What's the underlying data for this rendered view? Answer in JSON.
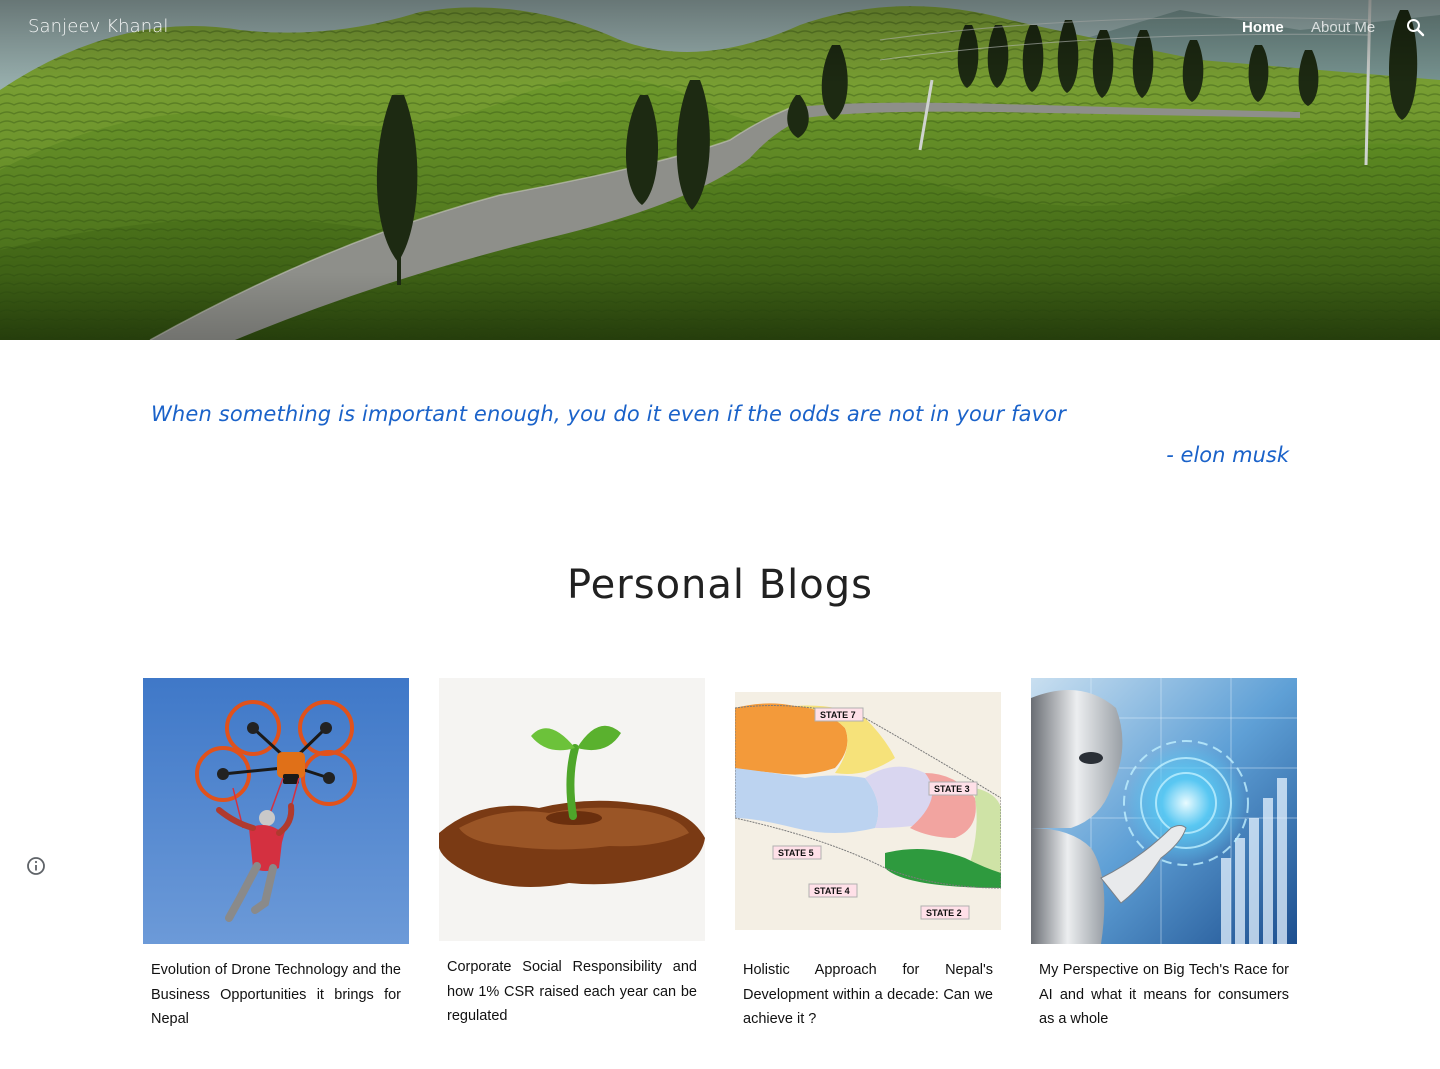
{
  "header": {
    "site_title": "Sanjeev Khanal",
    "nav": {
      "home": "Home",
      "about": "About Me"
    },
    "search_icon": "search-icon",
    "hero_image": "tea-garden-road-landscape"
  },
  "quote": {
    "text": "When something is important enough, you do it even if the odds are not in your favor",
    "author": "- elon musk"
  },
  "blogs": {
    "heading": "Personal Blogs",
    "cards": [
      {
        "title": "Evolution of Drone Technology and the Business Opportunities it brings for Nepal",
        "image": "drone-carrying-person"
      },
      {
        "title": "Corporate Social Responsibility and how 1% CSR raised each year can be regulated",
        "image": "sprout-in-soil"
      },
      {
        "title": "Holistic Approach for Nepal's Development within a decade: Can we achieve it ?",
        "image": "nepal-states-map"
      },
      {
        "title": "My Perspective on Big Tech's Race for AI and what it means for consumers as a whole",
        "image": "ai-robot"
      }
    ],
    "map_labels": {
      "state7": "STATE 7",
      "state3": "STATE 3",
      "state5": "STATE 5",
      "state4": "STATE 4",
      "state2": "STATE 2"
    }
  },
  "footer": {
    "info_icon": "info-icon"
  },
  "colors": {
    "quote_blue": "#1a62c9",
    "heading_dark": "#212121",
    "hero_green": "#4d7a1e"
  }
}
